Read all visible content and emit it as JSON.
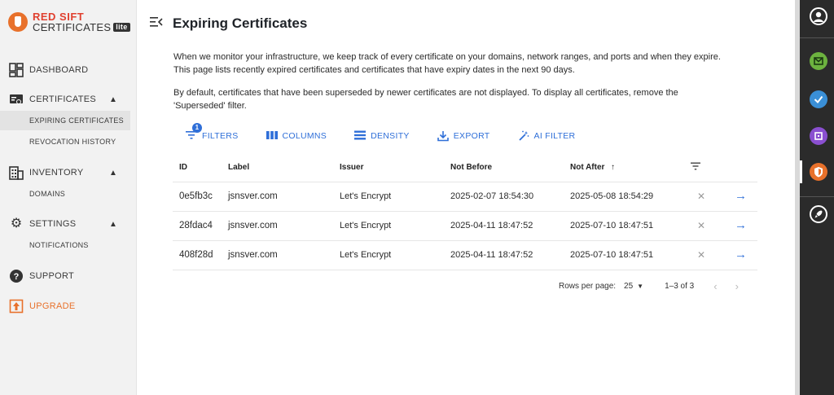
{
  "brand": {
    "line1": "RED SIFT",
    "line2": "CERTIFICATES",
    "badge": "lite"
  },
  "sidebar": {
    "dashboard": "DASHBOARD",
    "certificates": "CERTIFICATES",
    "expiring": "EXPIRING CERTIFICATES",
    "revocation": "REVOCATION HISTORY",
    "inventory": "INVENTORY",
    "domains": "DOMAINS",
    "settings": "SETTINGS",
    "notifications": "NOTIFICATIONS",
    "support": "SUPPORT",
    "upgrade": "UPGRADE"
  },
  "page": {
    "title": "Expiring Certificates",
    "desc1_line1": "When we monitor your infrastructure, we keep track of every certificate on your domains, network ranges, and ports and when they expire.",
    "desc1_line2": "This page lists recently expired certificates and certificates that have expiry dates in the next 90 days.",
    "desc2_line1": "By default, certificates that have been superseded by newer certificates are not displayed. To display all certificates, remove the",
    "desc2_line2": "'Superseded' filter."
  },
  "toolbar": {
    "filters": "FILTERS",
    "filters_count": "1",
    "columns": "COLUMNS",
    "density": "DENSITY",
    "export": "EXPORT",
    "ai_filter": "AI FILTER"
  },
  "table": {
    "headers": {
      "id": "ID",
      "label": "Label",
      "issuer": "Issuer",
      "not_before": "Not Before",
      "not_after": "Not After"
    },
    "rows": [
      {
        "id": "0e5fb3c",
        "label": "jsnsver.com",
        "issuer": "Let's Encrypt",
        "not_before": "2025-02-07 18:54:30",
        "not_after": "2025-05-08 18:54:29"
      },
      {
        "id": "28fdac4",
        "label": "jsnsver.com",
        "issuer": "Let's Encrypt",
        "not_before": "2025-04-11 18:47:52",
        "not_after": "2025-07-10 18:47:51"
      },
      {
        "id": "408f28d",
        "label": "jsnsver.com",
        "issuer": "Let's Encrypt",
        "not_before": "2025-04-11 18:47:52",
        "not_after": "2025-07-10 18:47:51"
      }
    ]
  },
  "pager": {
    "rows_label": "Rows per page:",
    "rows_value": "25",
    "range": "1–3 of 3"
  },
  "colors": {
    "accent": "#2f6fd8",
    "brand": "#e8712b",
    "rail": "#2b2b2b"
  }
}
